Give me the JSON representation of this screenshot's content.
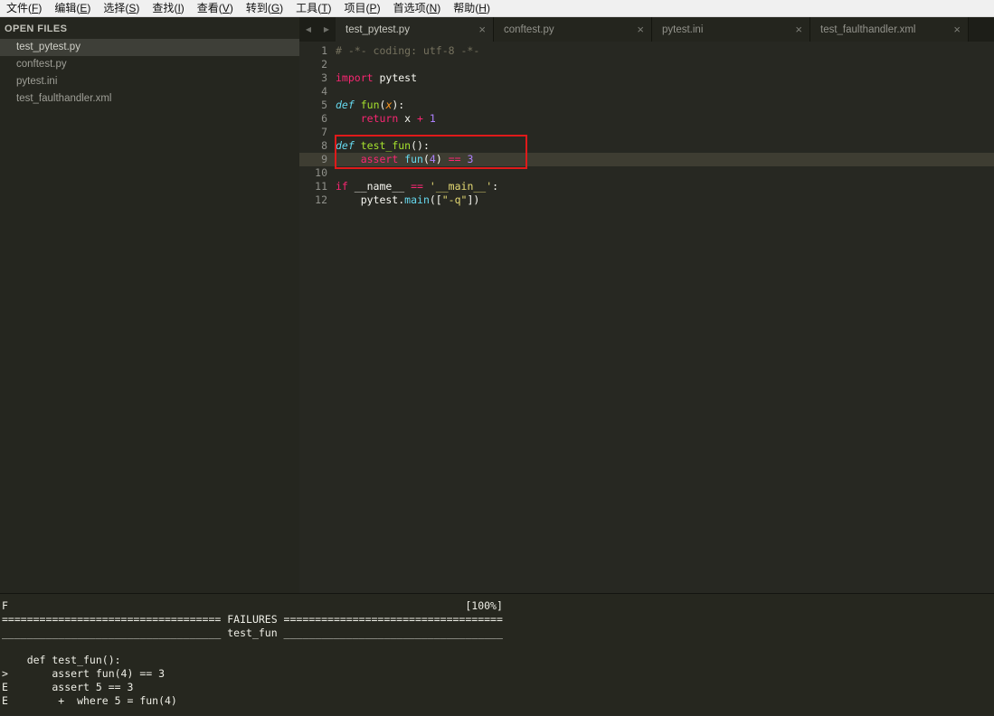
{
  "menu": {
    "items": [
      {
        "text": "文件",
        "key": "F"
      },
      {
        "text": "编辑",
        "key": "E"
      },
      {
        "text": "选择",
        "key": "S"
      },
      {
        "text": "查找",
        "key": "I"
      },
      {
        "text": "查看",
        "key": "V"
      },
      {
        "text": "转到",
        "key": "G"
      },
      {
        "text": "工具",
        "key": "T"
      },
      {
        "text": "项目",
        "key": "P"
      },
      {
        "text": "首选项",
        "key": "N"
      },
      {
        "text": "帮助",
        "key": "H"
      }
    ]
  },
  "sidebar": {
    "header": "OPEN FILES",
    "files": [
      {
        "name": "test_pytest.py",
        "selected": true
      },
      {
        "name": "conftest.py",
        "selected": false
      },
      {
        "name": "pytest.ini",
        "selected": false
      },
      {
        "name": "test_faulthandler.xml",
        "selected": false
      }
    ]
  },
  "tabbar": {
    "nav_left": "◀",
    "nav_right": "▶",
    "close_glyph": "×"
  },
  "tabs": [
    {
      "title": "test_pytest.py",
      "active": true
    },
    {
      "title": "conftest.py",
      "active": false
    },
    {
      "title": "pytest.ini",
      "active": false
    },
    {
      "title": "test_faulthandler.xml",
      "active": false
    }
  ],
  "editor": {
    "active_line": 9,
    "lines": [
      {
        "n": 1,
        "toks": [
          [
            "comment",
            "# -*- coding: utf-8 -*-"
          ]
        ]
      },
      {
        "n": 2,
        "toks": []
      },
      {
        "n": 3,
        "toks": [
          [
            "kw",
            "import"
          ],
          [
            "plain",
            " pytest"
          ]
        ]
      },
      {
        "n": 4,
        "toks": []
      },
      {
        "n": 5,
        "toks": [
          [
            "kwi",
            "def"
          ],
          [
            "plain",
            " "
          ],
          [
            "fn",
            "fun"
          ],
          [
            "plain",
            "("
          ],
          [
            "param",
            "x"
          ],
          [
            "plain",
            "):"
          ]
        ]
      },
      {
        "n": 6,
        "toks": [
          [
            "plain",
            "    "
          ],
          [
            "kw",
            "return"
          ],
          [
            "plain",
            " x "
          ],
          [
            "kw",
            "+"
          ],
          [
            "plain",
            " "
          ],
          [
            "num",
            "1"
          ]
        ]
      },
      {
        "n": 7,
        "toks": []
      },
      {
        "n": 8,
        "toks": [
          [
            "kwi",
            "def"
          ],
          [
            "plain",
            " "
          ],
          [
            "fn",
            "test_fun"
          ],
          [
            "plain",
            "():"
          ]
        ]
      },
      {
        "n": 9,
        "toks": [
          [
            "plain",
            "    "
          ],
          [
            "kw",
            "assert"
          ],
          [
            "plain",
            " "
          ],
          [
            "call",
            "fun"
          ],
          [
            "plain",
            "("
          ],
          [
            "num",
            "4"
          ],
          [
            "plain",
            ") "
          ],
          [
            "kw",
            "=="
          ],
          [
            "plain",
            " "
          ],
          [
            "num",
            "3"
          ]
        ]
      },
      {
        "n": 10,
        "toks": []
      },
      {
        "n": 11,
        "toks": [
          [
            "kw",
            "if"
          ],
          [
            "plain",
            " __name__ "
          ],
          [
            "kw",
            "=="
          ],
          [
            "plain",
            " "
          ],
          [
            "str",
            "'__main__'"
          ],
          [
            "plain",
            ":"
          ]
        ]
      },
      {
        "n": 12,
        "toks": [
          [
            "plain",
            "    pytest."
          ],
          [
            "call",
            "main"
          ],
          [
            "plain",
            "(["
          ],
          [
            "str",
            "\"-q\""
          ],
          [
            "plain",
            "])"
          ]
        ]
      }
    ]
  },
  "annotation": {
    "type": "red-highlight-box",
    "color": "#df1a1a",
    "target_lines": [
      8,
      9
    ]
  },
  "output": {
    "lines": [
      "F                                                                         [100%]",
      "=================================== FAILURES ===================================",
      "___________________________________ test_fun ___________________________________",
      "",
      "    def test_fun():",
      ">       assert fun(4) == 3",
      "E       assert 5 == 3",
      "E        +  where 5 = fun(4)"
    ]
  },
  "colors": {
    "editor_bg": "#272822",
    "sidebar_bg": "#25261f",
    "tabbar_bg": "#1d1e18",
    "annotation_red": "#df1a1a",
    "comment": "#75715e",
    "keyword": "#f92672",
    "function_def": "#a6e22e",
    "storage_type": "#66d9ef",
    "parameter": "#fd971f",
    "number": "#ae81ff",
    "string": "#e6db74",
    "foreground": "#f8f8f2"
  }
}
